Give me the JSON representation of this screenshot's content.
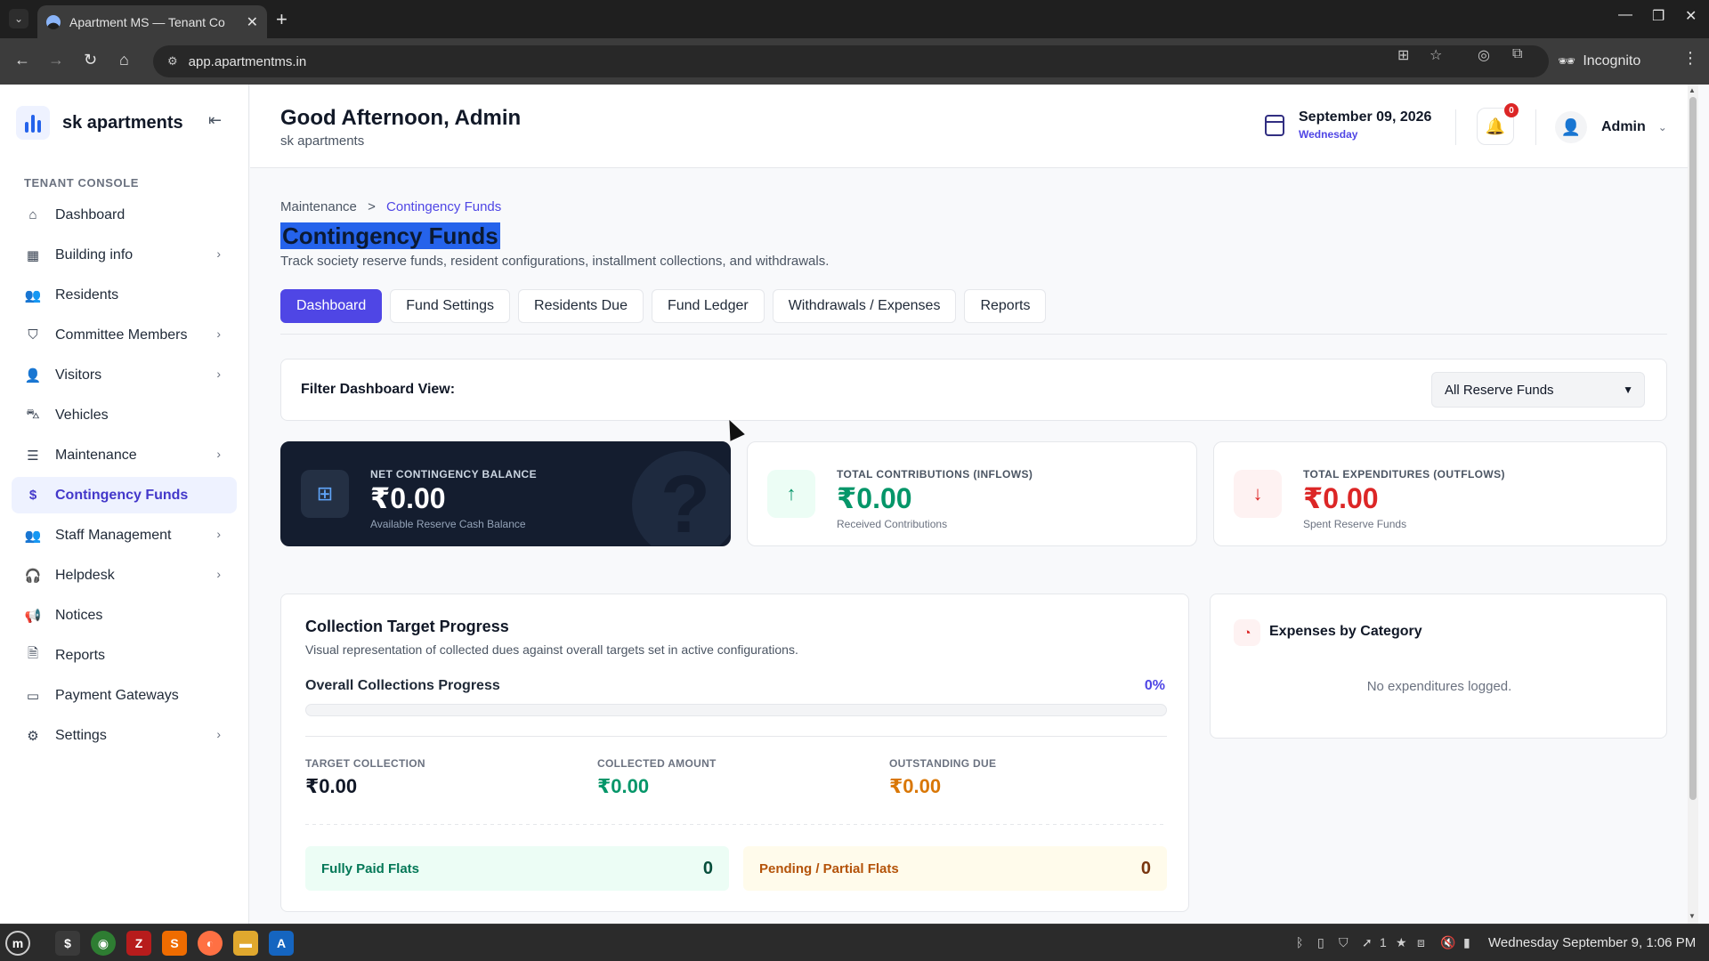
{
  "browser": {
    "tab_title": "Apartment MS — Tenant Co",
    "url": "app.apartmentms.in",
    "incognito_label": "Incognito"
  },
  "sidebar": {
    "brand": "sk apartments",
    "section_label": "TENANT CONSOLE",
    "items": [
      {
        "label": "Dashboard",
        "icon": "home-icon"
      },
      {
        "label": "Building info",
        "icon": "grid-icon"
      },
      {
        "label": "Residents",
        "icon": "users-icon"
      },
      {
        "label": "Committee Members",
        "icon": "shield-icon"
      },
      {
        "label": "Visitors",
        "icon": "user-plus-icon"
      },
      {
        "label": "Vehicles",
        "icon": "car-icon"
      },
      {
        "label": "Maintenance",
        "icon": "server-icon"
      },
      {
        "label": "Contingency Funds",
        "icon": "dollar-icon"
      },
      {
        "label": "Staff Management",
        "icon": "users-icon"
      },
      {
        "label": "Helpdesk",
        "icon": "headset-icon"
      },
      {
        "label": "Notices",
        "icon": "megaphone-icon"
      },
      {
        "label": "Reports",
        "icon": "document-icon"
      },
      {
        "label": "Payment Gateways",
        "icon": "card-icon"
      },
      {
        "label": "Settings",
        "icon": "gear-icon"
      }
    ]
  },
  "header": {
    "greeting": "Good Afternoon, Admin",
    "subtitle": "sk apartments",
    "date": "September 09, 2026",
    "weekday": "Wednesday",
    "notification_count": "0",
    "user": "Admin"
  },
  "page": {
    "breadcrumb_parent": "Maintenance",
    "breadcrumb_sep": ">",
    "breadcrumb_current": "Contingency Funds",
    "title": "Contingency Funds",
    "description": "Track society reserve funds, resident configurations, installment collections, and withdrawals.",
    "tabs": [
      "Dashboard",
      "Fund Settings",
      "Residents Due",
      "Fund Ledger",
      "Withdrawals / Expenses",
      "Reports"
    ]
  },
  "filter": {
    "label": "Filter Dashboard View:",
    "selected": "All Reserve Funds"
  },
  "stats": {
    "net": {
      "label": "NET CONTINGENCY BALANCE",
      "value": "₹0.00",
      "sub": "Available Reserve Cash Balance",
      "watermark": "?"
    },
    "inflow": {
      "label": "TOTAL CONTRIBUTIONS (INFLOWS)",
      "value": "₹0.00",
      "sub": "Received Contributions"
    },
    "outflow": {
      "label": "TOTAL EXPENDITURES (OUTFLOWS)",
      "value": "₹0.00",
      "sub": "Spent Reserve Funds"
    }
  },
  "progress": {
    "title": "Collection Target Progress",
    "subtitle": "Visual representation of collected dues against overall targets set in active configurations.",
    "overall_label": "Overall Collections Progress",
    "percent_label": "0%",
    "percent": 0,
    "target_label": "TARGET COLLECTION",
    "target_value": "₹0.00",
    "collected_label": "COLLECTED AMOUNT",
    "collected_value": "₹0.00",
    "outstanding_label": "OUTSTANDING DUE",
    "outstanding_value": "₹0.00",
    "fully_paid_label": "Fully Paid Flats",
    "fully_paid_count": "0",
    "pending_label": "Pending / Partial Flats",
    "pending_count": "0"
  },
  "expenses": {
    "title": "Expenses by Category",
    "empty": "No expenditures logged."
  },
  "taskbar": {
    "clock": "Wednesday September 9, 1:06 PM",
    "badge": "1"
  },
  "colors": {
    "accent": "#4f46e5",
    "dark_card": "#141d2f",
    "green": "#059669",
    "red": "#dc2626",
    "amber": "#d97706"
  }
}
